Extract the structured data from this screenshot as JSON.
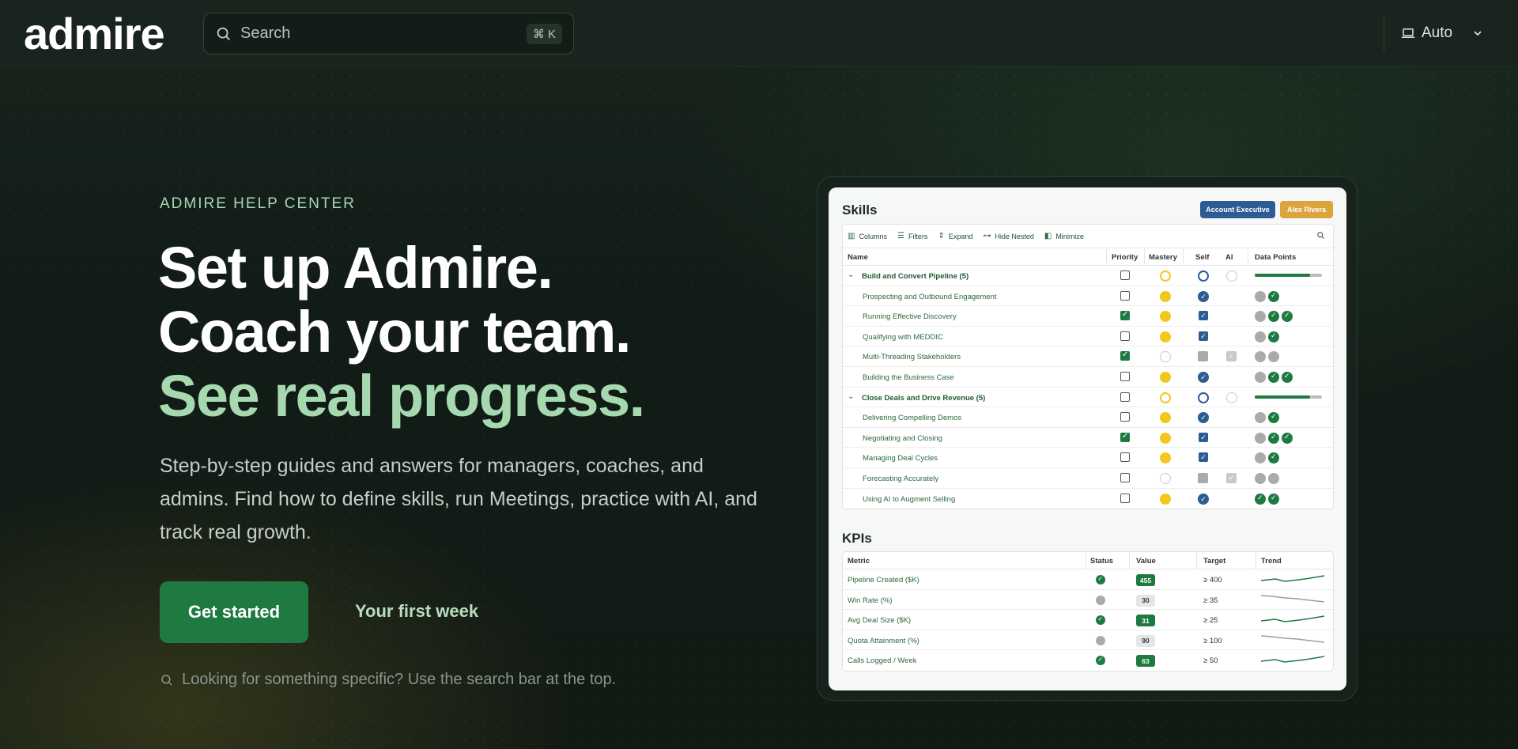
{
  "header": {
    "logo": "admire",
    "search_placeholder": "Search",
    "search_shortcut": "⌘ K",
    "theme_label": "Auto"
  },
  "hero": {
    "eyebrow": "ADMIRE HELP CENTER",
    "headline_1": "Set up Admire.",
    "headline_2": "Coach your team.",
    "headline_3": "See real progress.",
    "lead": "Step-by-step guides and answers for managers, coaches, and admins. Find how to define skills, run Meetings, practice with AI, and track real growth.",
    "primary_cta": "Get started",
    "secondary_cta": "Your first week",
    "hint": "Looking for something specific? Use the search bar at the top."
  },
  "preview": {
    "skills_title": "Skills",
    "role_pill": "Account Executive",
    "user_pill": "Alex Rivera",
    "toolbar": [
      "Columns",
      "Filters",
      "Expand",
      "Hide Nested",
      "Minimize"
    ],
    "columns": [
      "Name",
      "Priority",
      "Mastery",
      "Self",
      "AI",
      "Data Points"
    ],
    "rows": [
      {
        "name": "Build and Convert Pipeline (5)",
        "group": true,
        "priority": false,
        "mastery": "ring",
        "self": "ring",
        "ai": "spin",
        "progress": 0.82
      },
      {
        "name": "Prospecting and Outbound Engagement",
        "group": false,
        "priority": false,
        "mastery": "full",
        "self": "badge",
        "ai": "",
        "dp": [
          "g",
          "ok"
        ]
      },
      {
        "name": "Running Effective Discovery",
        "group": false,
        "priority": true,
        "mastery": "full",
        "self": "box",
        "ai": "",
        "dp": [
          "g",
          "ok",
          "ok"
        ]
      },
      {
        "name": "Qualifying with MEDDIC",
        "group": false,
        "priority": false,
        "mastery": "full",
        "self": "box",
        "ai": "",
        "dp": [
          "g",
          "ok"
        ]
      },
      {
        "name": "Multi-Threading Stakeholders",
        "group": false,
        "priority": true,
        "mastery": "empty",
        "self": "grey",
        "ai": "box",
        "dp": [
          "g",
          "g"
        ]
      },
      {
        "name": "Building the Business Case",
        "group": false,
        "priority": false,
        "mastery": "full",
        "self": "badge",
        "ai": "",
        "dp": [
          "g",
          "ok",
          "ok"
        ]
      },
      {
        "name": "Close Deals and Drive Revenue (5)",
        "group": true,
        "priority": false,
        "mastery": "ring",
        "self": "ring",
        "ai": "spin",
        "progress": 0.82
      },
      {
        "name": "Delivering Compelling Demos",
        "group": false,
        "priority": false,
        "mastery": "full",
        "self": "badge",
        "ai": "",
        "dp": [
          "g",
          "ok"
        ]
      },
      {
        "name": "Negotiating and Closing",
        "group": false,
        "priority": true,
        "mastery": "full",
        "self": "box",
        "ai": "",
        "dp": [
          "g",
          "ok",
          "ok"
        ]
      },
      {
        "name": "Managing Deal Cycles",
        "group": false,
        "priority": false,
        "mastery": "full",
        "self": "box",
        "ai": "",
        "dp": [
          "g",
          "ok"
        ]
      },
      {
        "name": "Forecasting Accurately",
        "group": false,
        "priority": false,
        "mastery": "empty",
        "self": "grey",
        "ai": "box",
        "dp": [
          "g",
          "g"
        ]
      },
      {
        "name": "Using AI to Augment Selling",
        "group": false,
        "priority": false,
        "mastery": "full",
        "self": "badge",
        "ai": "",
        "dp": [
          "ok",
          "ok"
        ]
      }
    ],
    "kpis_title": "KPIs",
    "kpi_columns": [
      "Metric",
      "Status",
      "Value",
      "Target",
      "Trend"
    ],
    "kpis": [
      {
        "metric": "Pipeline Created ($K)",
        "status": "good",
        "value": "455",
        "target": "≥ 400",
        "trend": "up"
      },
      {
        "metric": "Win Rate (%)",
        "status": "neutral",
        "value": "30",
        "target": "≥ 35",
        "trend": "down"
      },
      {
        "metric": "Avg Deal Size ($K)",
        "status": "good",
        "value": "31",
        "target": "≥ 25",
        "trend": "up"
      },
      {
        "metric": "Quota Attainment (%)",
        "status": "neutral",
        "value": "90",
        "target": "≥ 100",
        "trend": "down"
      },
      {
        "metric": "Calls Logged / Week",
        "status": "good",
        "value": "63",
        "target": "≥ 50",
        "trend": "up"
      }
    ]
  },
  "colors": {
    "brand_green": "#1f7a41",
    "accent_text": "#a6d9b0",
    "skill_blue": "#2d5b94",
    "mastery_yellow": "#f2c81c",
    "user_orange": "#dca43c"
  }
}
